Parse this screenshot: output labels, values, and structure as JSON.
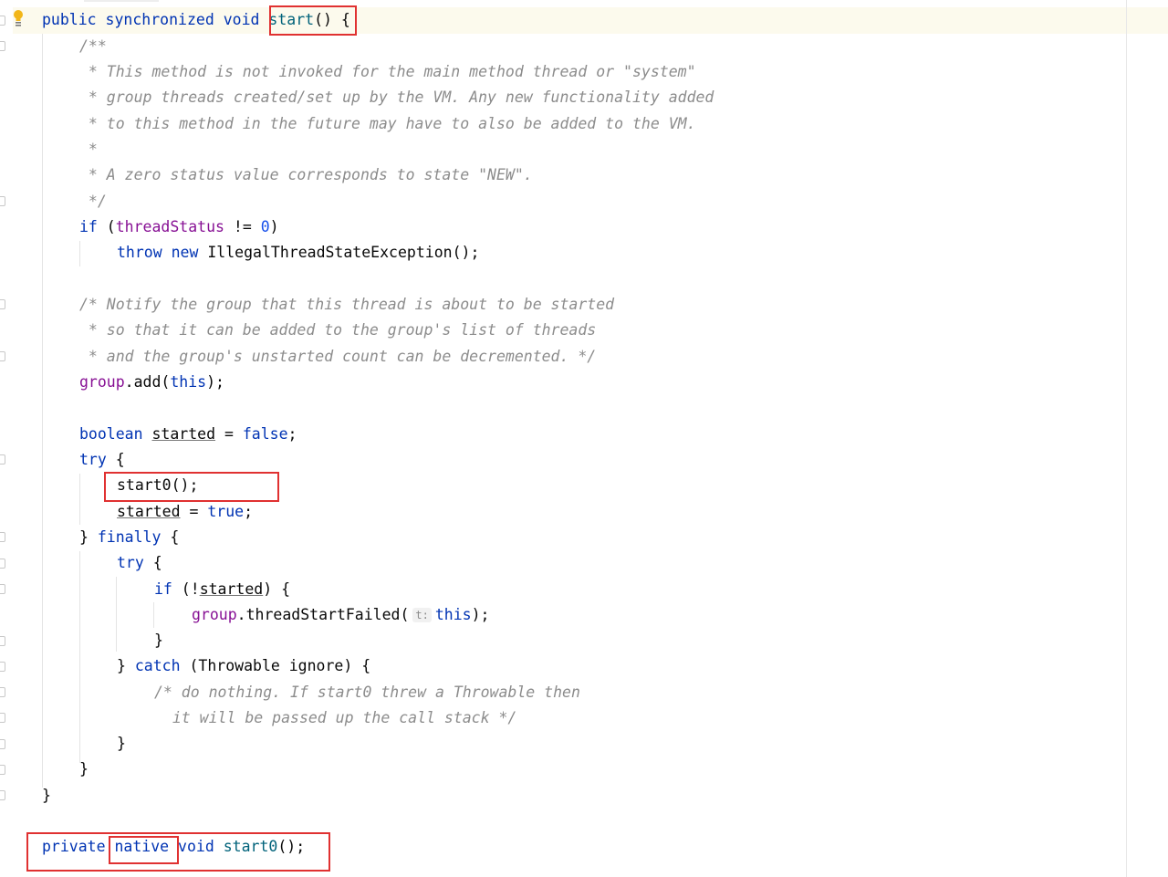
{
  "editor": {
    "lines": {
      "l1": [
        "public",
        "synchronized",
        "void",
        "start",
        "() {"
      ],
      "l2": "/**",
      "l3": " * This method is not invoked for the main method thread or \"system\"",
      "l4": " * group threads created/set up by the VM. Any new functionality added",
      "l5": " * to this method in the future may have to also be added to the VM.",
      "l6": " *",
      "l7": " * A zero status value corresponds to state \"NEW\".",
      "l8": " */",
      "l9": [
        "if",
        " (",
        "threadStatus",
        " != ",
        "0",
        ")"
      ],
      "l10": [
        "throw",
        "new",
        "IllegalThreadStateException();"
      ],
      "l12": "/* Notify the group that this thread is about to be started",
      "l13": " * so that it can be added to the group's list of threads",
      "l14": " * and the group's unstarted count can be decremented. */",
      "l15": [
        "group",
        ".add(",
        "this",
        ");"
      ],
      "l17": [
        "boolean",
        "started",
        " = ",
        "false",
        ";"
      ],
      "l18": [
        "try",
        " {"
      ],
      "l19": "start0();",
      "l20": [
        "started",
        " = ",
        "true",
        ";"
      ],
      "l21": [
        "} ",
        "finally",
        " {"
      ],
      "l22": [
        "try",
        " {"
      ],
      "l23": [
        "if",
        " (!",
        "started",
        ") {"
      ],
      "l24": [
        "group",
        ".threadStartFailed(",
        "t:",
        "this",
        ");"
      ],
      "l25": "}",
      "l26": [
        "} ",
        "catch",
        " (Throwable ignore) {"
      ],
      "l27": "/* do nothing. If start0 threw a Throwable then",
      "l28": "  it will be passed up the call stack */",
      "l29": "}",
      "l30": "}",
      "l31": "}",
      "l33": [
        "private",
        "native",
        "void",
        "start0",
        "();"
      ]
    }
  },
  "colors": {
    "keyword": "#0033b3",
    "field": "#871094",
    "number": "#1750eb",
    "comment": "#8c8c8c",
    "method_decl": "#00627a",
    "highlight_box": "#e03131",
    "caret_row": "#fcfaed"
  },
  "icons": {
    "gutter": "lightbulb-icon"
  }
}
